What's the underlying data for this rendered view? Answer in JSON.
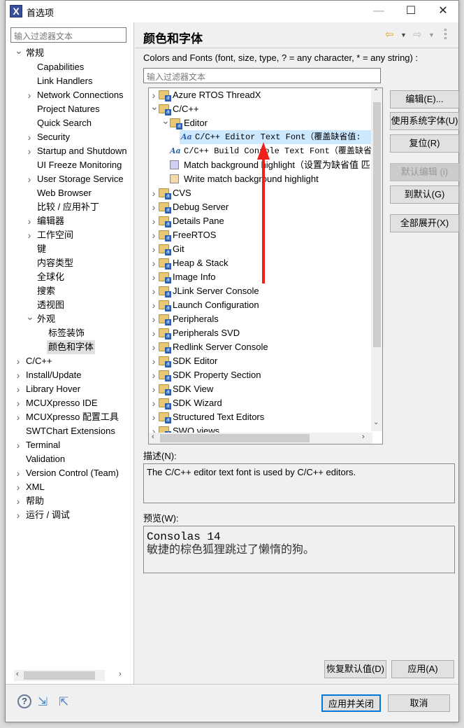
{
  "window": {
    "title": "首选项",
    "minimize": "—",
    "maximize": "☐",
    "close": "✕"
  },
  "left": {
    "filter_placeholder": "输入过滤器文本",
    "items": [
      {
        "label": "常规",
        "level": 0,
        "state": "open"
      },
      {
        "label": "Capabilities",
        "level": 1
      },
      {
        "label": "Link Handlers",
        "level": 1
      },
      {
        "label": "Network Connections",
        "level": 1,
        "state": "closed"
      },
      {
        "label": "Project Natures",
        "level": 1
      },
      {
        "label": "Quick Search",
        "level": 1
      },
      {
        "label": "Security",
        "level": 1,
        "state": "closed"
      },
      {
        "label": "Startup and Shutdown",
        "level": 1,
        "state": "closed"
      },
      {
        "label": "UI Freeze Monitoring",
        "level": 1
      },
      {
        "label": "User Storage Service",
        "level": 1,
        "state": "closed"
      },
      {
        "label": "Web Browser",
        "level": 1
      },
      {
        "label": "比较 / 应用补丁",
        "level": 1
      },
      {
        "label": "编辑器",
        "level": 1,
        "state": "closed"
      },
      {
        "label": "工作空间",
        "level": 1,
        "state": "closed"
      },
      {
        "label": "键",
        "level": 1
      },
      {
        "label": "内容类型",
        "level": 1
      },
      {
        "label": "全球化",
        "level": 1
      },
      {
        "label": "搜索",
        "level": 1
      },
      {
        "label": "透视图",
        "level": 1
      },
      {
        "label": "外观",
        "level": 1,
        "state": "open"
      },
      {
        "label": "标签装饰",
        "level": 2
      },
      {
        "label": "颜色和字体",
        "level": 2,
        "selected": true
      },
      {
        "label": "C/C++",
        "level": 0,
        "state": "closed"
      },
      {
        "label": "Install/Update",
        "level": 0,
        "state": "closed"
      },
      {
        "label": "Library Hover",
        "level": 0,
        "state": "closed"
      },
      {
        "label": "MCUXpresso IDE",
        "level": 0,
        "state": "closed"
      },
      {
        "label": "MCUXpresso 配置工具",
        "level": 0,
        "state": "closed"
      },
      {
        "label": "SWTChart Extensions",
        "level": 0
      },
      {
        "label": "Terminal",
        "level": 0,
        "state": "closed"
      },
      {
        "label": "Validation",
        "level": 0
      },
      {
        "label": "Version Control (Team)",
        "level": 0,
        "state": "closed"
      },
      {
        "label": "XML",
        "level": 0,
        "state": "closed"
      },
      {
        "label": "帮助",
        "level": 0,
        "state": "closed"
      },
      {
        "label": "运行 / 调试",
        "level": 0,
        "state": "closed"
      }
    ]
  },
  "main": {
    "title": "颜色和字体",
    "back_icon": "back-arrow-icon",
    "forward_icon": "forward-arrow-icon",
    "filter_label": "Colors and Fonts (font, size, type, ? = any character, * = any string) :",
    "filter_placeholder": "输入过滤器文本",
    "tree": [
      {
        "label": "Azure RTOS ThreadX",
        "level": 0,
        "state": "closed",
        "icon": "folder"
      },
      {
        "label": "C/C++",
        "level": 0,
        "state": "open",
        "icon": "folder"
      },
      {
        "label": "Editor",
        "level": 1,
        "state": "open",
        "icon": "folder"
      },
      {
        "label": "C/C++ Editor Text Font（覆盖缺省值: ",
        "level": 2,
        "icon": "font",
        "selected": true,
        "mono": true
      },
      {
        "label": "C/C++ Build Console Text Font（覆盖缺省值",
        "level": 1,
        "icon": "font",
        "mono": true
      },
      {
        "label": "Match background highlight（设置为缺省值 匹",
        "level": 1,
        "icon": "color",
        "color": "#d0d0f4"
      },
      {
        "label": "Write match background highlight",
        "level": 1,
        "icon": "color",
        "color": "#f2d9aa"
      },
      {
        "label": "CVS",
        "level": 0,
        "state": "closed",
        "icon": "folder"
      },
      {
        "label": "Debug Server",
        "level": 0,
        "state": "closed",
        "icon": "folder"
      },
      {
        "label": "Details Pane",
        "level": 0,
        "state": "closed",
        "icon": "folder"
      },
      {
        "label": "FreeRTOS",
        "level": 0,
        "state": "closed",
        "icon": "folder"
      },
      {
        "label": "Git",
        "level": 0,
        "state": "closed",
        "icon": "folder"
      },
      {
        "label": "Heap & Stack",
        "level": 0,
        "state": "closed",
        "icon": "folder"
      },
      {
        "label": "Image Info",
        "level": 0,
        "state": "closed",
        "icon": "folder"
      },
      {
        "label": "JLink Server Console",
        "level": 0,
        "state": "closed",
        "icon": "folder"
      },
      {
        "label": "Launch Configuration",
        "level": 0,
        "state": "closed",
        "icon": "folder"
      },
      {
        "label": "Peripherals",
        "level": 0,
        "state": "closed",
        "icon": "folder"
      },
      {
        "label": "Peripherals SVD",
        "level": 0,
        "state": "closed",
        "icon": "folder"
      },
      {
        "label": "Redlink Server Console",
        "level": 0,
        "state": "closed",
        "icon": "folder"
      },
      {
        "label": "SDK Editor",
        "level": 0,
        "state": "closed",
        "icon": "folder"
      },
      {
        "label": "SDK Property Section",
        "level": 0,
        "state": "closed",
        "icon": "folder"
      },
      {
        "label": "SDK View",
        "level": 0,
        "state": "closed",
        "icon": "folder"
      },
      {
        "label": "SDK Wizard",
        "level": 0,
        "state": "closed",
        "icon": "folder"
      },
      {
        "label": "Structured Text Editors",
        "level": 0,
        "state": "closed",
        "icon": "folder"
      },
      {
        "label": "SWO views",
        "level": 0,
        "state": "closed",
        "icon": "folder"
      }
    ],
    "buttons": {
      "edit": "编辑(E)...",
      "system_font": "使用系统字体(U)",
      "reset": "复位(R)",
      "edit_default": "默认编辑 (i)",
      "go_default": "到默认(G)",
      "expand_all": "全部展开(X)"
    },
    "description_label": "描述(N):",
    "description": "The C/C++ editor text font is used by C/C++ editors.",
    "preview_label": "预览(W):",
    "preview_line1": "Consolas 14",
    "preview_line2": "敏捷的棕色狐狸跳过了懒惰的狗。",
    "restore_defaults": "恢复默认值(D)",
    "apply": "应用(A)"
  },
  "footer": {
    "apply_close": "应用并关闭",
    "cancel": "取消",
    "accent": "#0078d7"
  },
  "annotation": {
    "arrow_color": "#f0201a"
  }
}
